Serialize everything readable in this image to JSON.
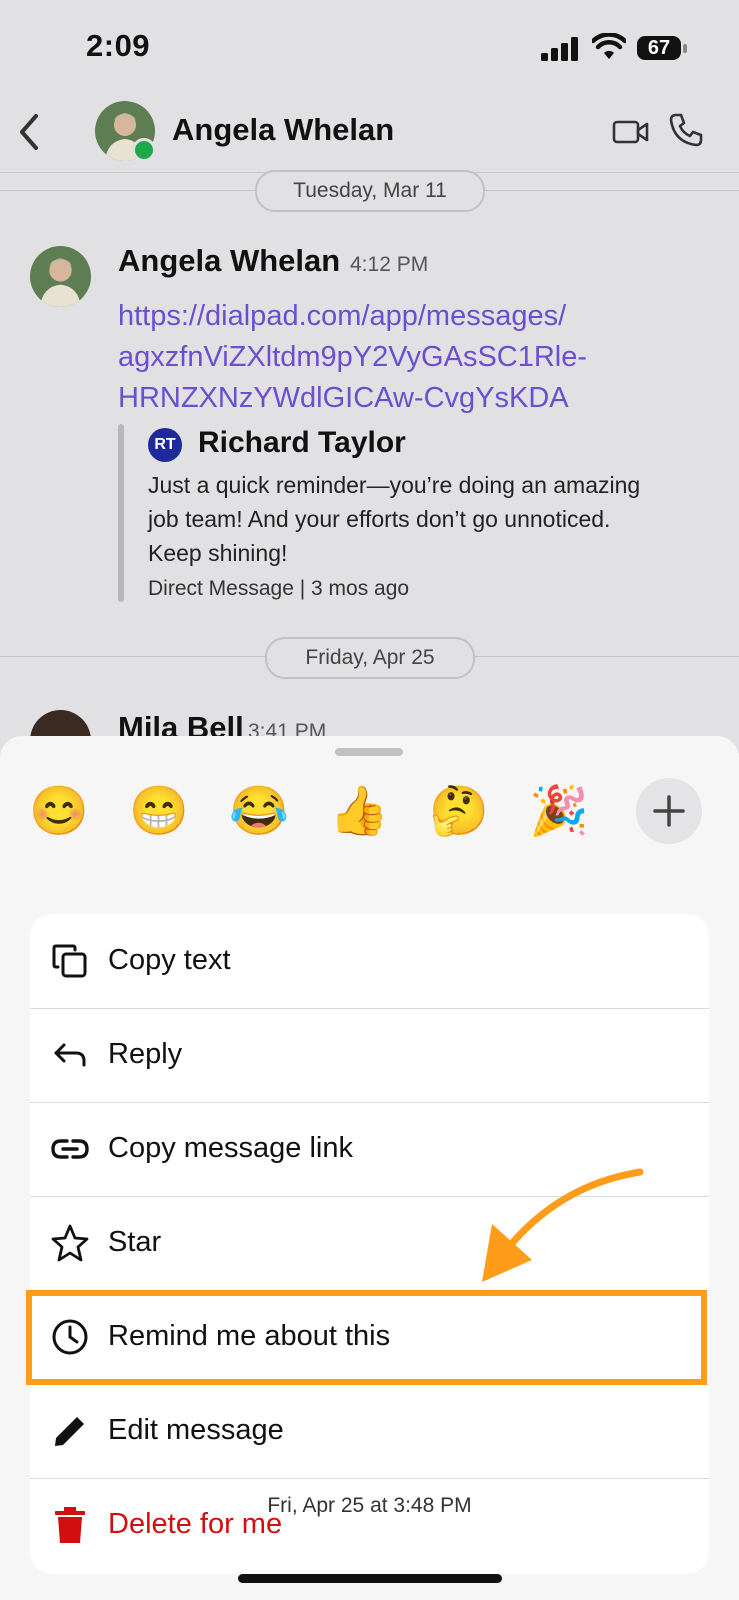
{
  "status_bar": {
    "time": "2:09",
    "battery": "67"
  },
  "header": {
    "contact_name": "Angela Whelan"
  },
  "conversation": {
    "dates": [
      "Tuesday, Mar 11",
      "Friday, Apr 25"
    ],
    "message": {
      "sender": "Angela Whelan",
      "time": "4:12 PM",
      "link_lines": [
        "https://dialpad.com/app/messages/",
        "agxzfnViZXltdm9pY2VyGAsSC1Rle-",
        "HRNZXNzYWdlGICAw-CvgYsKDA"
      ]
    },
    "quote": {
      "initials": "RT",
      "author": "Richard Taylor",
      "text_lines": [
        "Just a quick reminder—you’re doing an amazing",
        "job team! And your efforts don’t go unnoticed.",
        "Keep shining!"
      ],
      "meta": "Direct Message | 3 mos ago"
    },
    "next_message": {
      "sender": "Mila Bell",
      "time": "3:41 PM"
    }
  },
  "sheet": {
    "reactions": [
      "😊",
      "😁",
      "😂",
      "👍",
      "🤔",
      "🎉"
    ],
    "menu": {
      "copy_text": "Copy text",
      "reply": "Reply",
      "copy_message_link": "Copy message link",
      "star": "Star",
      "remind": "Remind me about this",
      "edit": "Edit message",
      "delete": "Delete for me"
    },
    "timestamp": "Fri, Apr 25 at 3:48 PM"
  },
  "colors": {
    "accent_link": "#6a4fd0",
    "highlight": "#ff9c1a",
    "danger": "#d10f0f",
    "presence": "#1fa84a"
  }
}
